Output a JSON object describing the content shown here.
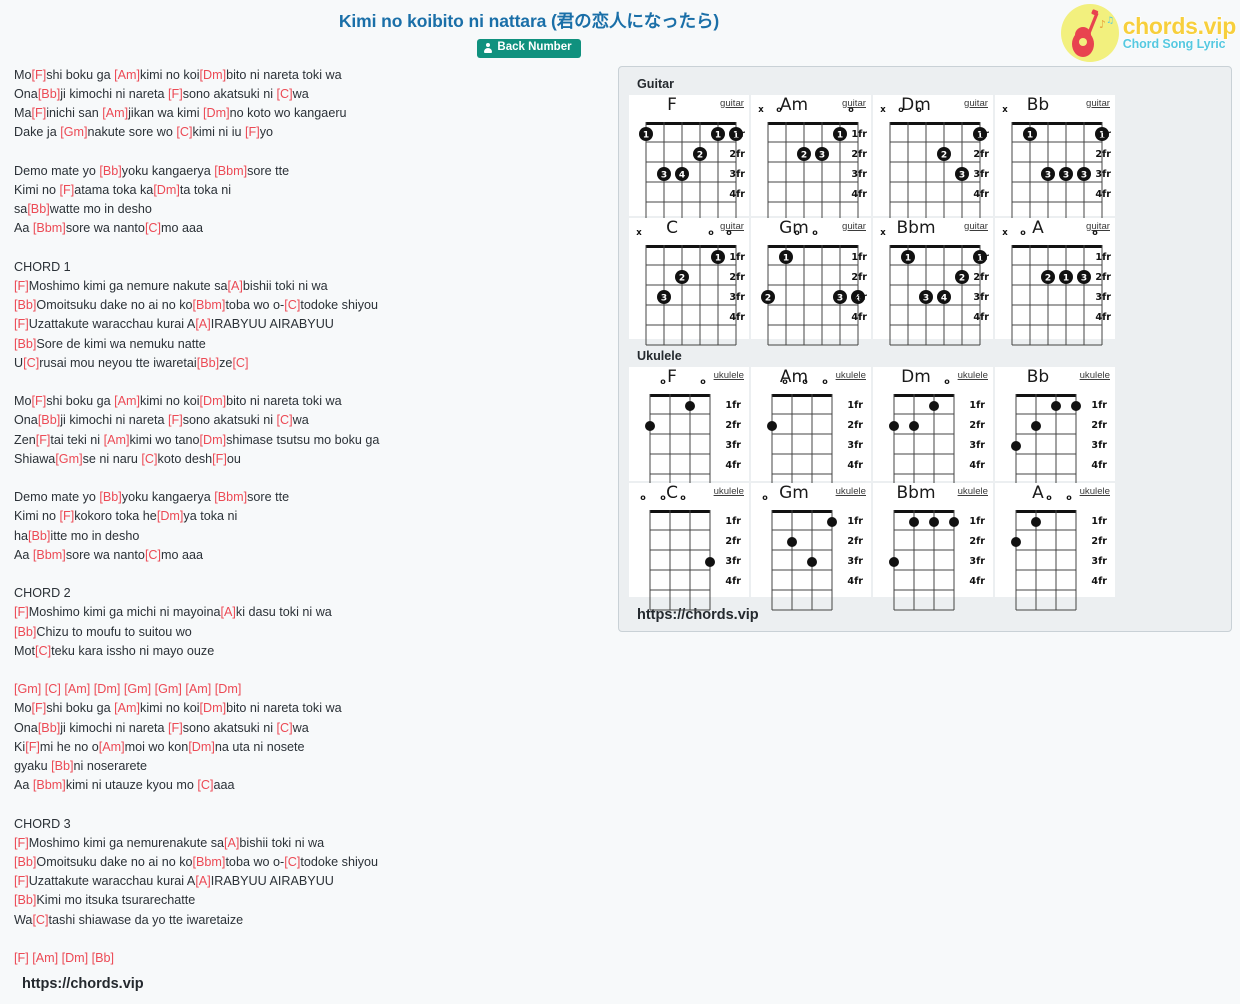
{
  "header": {
    "title": "Kimi no koibito ni nattara (君の恋人になったら)",
    "artist": "Back Number",
    "artist_icon": "user-icon"
  },
  "logo": {
    "main": "chords.vip",
    "sub": "Chord Song Lyric",
    "icon": "guitar-icon",
    "circle_color": "#f2f07e",
    "main_color": "#f7cf3c",
    "sub_color": "#55c8e0"
  },
  "colors": {
    "title": "#1a6fa8",
    "chord": "#ec4a55",
    "badge_bg": "#10917e",
    "panel_bg": "#eceff1",
    "panel_border": "#c9d1d6"
  },
  "lyrics": {
    "lines": [
      [
        {
          "t": "Mo"
        },
        {
          "c": "[F]"
        },
        {
          "t": "shi boku ga "
        },
        {
          "c": "[Am]"
        },
        {
          "t": "kimi no koi"
        },
        {
          "c": "[Dm]"
        },
        {
          "t": "bito ni nareta toki wa"
        }
      ],
      [
        {
          "t": "Ona"
        },
        {
          "c": "[Bb]"
        },
        {
          "t": "ji kimochi ni nareta "
        },
        {
          "c": "[F]"
        },
        {
          "t": "sono akatsuki ni "
        },
        {
          "c": "[C]"
        },
        {
          "t": "wa"
        }
      ],
      [
        {
          "t": "Ma"
        },
        {
          "c": "[F]"
        },
        {
          "t": "inichi san "
        },
        {
          "c": "[Am]"
        },
        {
          "t": "jikan wa kimi "
        },
        {
          "c": "[Dm]"
        },
        {
          "t": "no koto wo kangaeru"
        }
      ],
      [
        {
          "t": "Dake ja "
        },
        {
          "c": "[Gm]"
        },
        {
          "t": "nakute sore wo "
        },
        {
          "c": "[C]"
        },
        {
          "t": "kimi ni iu "
        },
        {
          "c": "[F]"
        },
        {
          "t": "yo"
        }
      ],
      [],
      [
        {
          "t": "Demo mate yo "
        },
        {
          "c": "[Bb]"
        },
        {
          "t": "yoku kangaerya "
        },
        {
          "c": "[Bbm]"
        },
        {
          "t": "sore tte"
        }
      ],
      [
        {
          "t": "Kimi no "
        },
        {
          "c": "[F]"
        },
        {
          "t": "atama toka ka"
        },
        {
          "c": "[Dm]"
        },
        {
          "t": "ta toka ni"
        }
      ],
      [
        {
          "t": "sa"
        },
        {
          "c": "[Bb]"
        },
        {
          "t": "watte mo in desho"
        }
      ],
      [
        {
          "t": "Aa "
        },
        {
          "c": "[Bbm]"
        },
        {
          "t": "sore wa nanto"
        },
        {
          "c": "[C]"
        },
        {
          "t": "mo aaa"
        }
      ],
      [],
      [
        {
          "t": "CHORD 1"
        }
      ],
      [
        {
          "c": "[F]"
        },
        {
          "t": "Moshimo kimi ga nemure nakute sa"
        },
        {
          "c": "[A]"
        },
        {
          "t": "bishii toki ni wa"
        }
      ],
      [
        {
          "c": "[Bb]"
        },
        {
          "t": "Omoitsuku dake no ai no ko"
        },
        {
          "c": "[Bbm]"
        },
        {
          "t": "toba wo o-"
        },
        {
          "c": "[C]"
        },
        {
          "t": "todoke shiyou"
        }
      ],
      [
        {
          "c": "[F]"
        },
        {
          "t": "Uzattakute waracchau kurai A"
        },
        {
          "c": "[A]"
        },
        {
          "t": "IRABYUU AIRABYUU"
        }
      ],
      [
        {
          "c": "[Bb]"
        },
        {
          "t": "Sore de kimi wa nemuku natte"
        }
      ],
      [
        {
          "t": "U"
        },
        {
          "c": "[C]"
        },
        {
          "t": "rusai mou neyou tte iwaretai"
        },
        {
          "c": "[Bb]"
        },
        {
          "t": "ze"
        },
        {
          "c": "[C]"
        }
      ],
      [],
      [
        {
          "t": "Mo"
        },
        {
          "c": "[F]"
        },
        {
          "t": "shi boku ga "
        },
        {
          "c": "[Am]"
        },
        {
          "t": "kimi no koi"
        },
        {
          "c": "[Dm]"
        },
        {
          "t": "bito ni nareta toki wa"
        }
      ],
      [
        {
          "t": "Ona"
        },
        {
          "c": "[Bb]"
        },
        {
          "t": "ji kimochi ni nareta "
        },
        {
          "c": "[F]"
        },
        {
          "t": "sono akatsuki ni "
        },
        {
          "c": "[C]"
        },
        {
          "t": "wa"
        }
      ],
      [
        {
          "t": "Zen"
        },
        {
          "c": "[F]"
        },
        {
          "t": "tai teki ni "
        },
        {
          "c": "[Am]"
        },
        {
          "t": "kimi wo tano"
        },
        {
          "c": "[Dm]"
        },
        {
          "t": "shimase tsutsu mo boku ga"
        }
      ],
      [
        {
          "t": "Shiawa"
        },
        {
          "c": "[Gm]"
        },
        {
          "t": "se ni naru "
        },
        {
          "c": "[C]"
        },
        {
          "t": "koto desh"
        },
        {
          "c": "[F]"
        },
        {
          "t": "ou"
        }
      ],
      [],
      [
        {
          "t": "Demo mate yo "
        },
        {
          "c": "[Bb]"
        },
        {
          "t": "yoku kangaerya "
        },
        {
          "c": "[Bbm]"
        },
        {
          "t": "sore tte"
        }
      ],
      [
        {
          "t": "Kimi no "
        },
        {
          "c": "[F]"
        },
        {
          "t": "kokoro toka he"
        },
        {
          "c": "[Dm]"
        },
        {
          "t": "ya toka ni"
        }
      ],
      [
        {
          "t": "ha"
        },
        {
          "c": "[Bb]"
        },
        {
          "t": "itte mo in desho"
        }
      ],
      [
        {
          "t": "Aa "
        },
        {
          "c": "[Bbm]"
        },
        {
          "t": "sore wa nanto"
        },
        {
          "c": "[C]"
        },
        {
          "t": "mo aaa"
        }
      ],
      [],
      [
        {
          "t": "CHORD 2"
        }
      ],
      [
        {
          "c": "[F]"
        },
        {
          "t": "Moshimo kimi ga michi ni mayoina"
        },
        {
          "c": "[A]"
        },
        {
          "t": "ki dasu toki ni wa"
        }
      ],
      [
        {
          "c": "[Bb]"
        },
        {
          "t": "Chizu to moufu to suitou wo"
        }
      ],
      [
        {
          "t": "Mot"
        },
        {
          "c": "[C]"
        },
        {
          "t": "teku kara issho ni mayo ouze"
        }
      ],
      [],
      [
        {
          "c": "[Gm] [C] [Am] [Dm] [Gm] [Gm] [Am] [Dm]"
        }
      ],
      [
        {
          "t": "Mo"
        },
        {
          "c": "[F]"
        },
        {
          "t": "shi boku ga "
        },
        {
          "c": "[Am]"
        },
        {
          "t": "kimi no koi"
        },
        {
          "c": "[Dm]"
        },
        {
          "t": "bito ni nareta toki wa"
        }
      ],
      [
        {
          "t": "Ona"
        },
        {
          "c": "[Bb]"
        },
        {
          "t": "ji kimochi ni nareta "
        },
        {
          "c": "[F]"
        },
        {
          "t": "sono akatsuki ni "
        },
        {
          "c": "[C]"
        },
        {
          "t": "wa"
        }
      ],
      [
        {
          "t": "Ki"
        },
        {
          "c": "[F]"
        },
        {
          "t": "mi he no o"
        },
        {
          "c": "[Am]"
        },
        {
          "t": "moi wo kon"
        },
        {
          "c": "[Dm]"
        },
        {
          "t": "na uta ni nosete"
        }
      ],
      [
        {
          "t": "gyaku "
        },
        {
          "c": "[Bb]"
        },
        {
          "t": "ni noserarete"
        }
      ],
      [
        {
          "t": "Aa "
        },
        {
          "c": "[Bbm]"
        },
        {
          "t": "kimi ni utauze kyou mo "
        },
        {
          "c": "[C]"
        },
        {
          "t": "aaa"
        }
      ],
      [],
      [
        {
          "t": "CHORD 3"
        }
      ],
      [
        {
          "c": "[F]"
        },
        {
          "t": "Moshimo kimi ga nemurenakute sa"
        },
        {
          "c": "[A]"
        },
        {
          "t": "bishii toki ni wa"
        }
      ],
      [
        {
          "c": "[Bb]"
        },
        {
          "t": "Omoitsuku dake no ai no ko"
        },
        {
          "c": "[Bbm]"
        },
        {
          "t": "toba wo o-"
        },
        {
          "c": "[C]"
        },
        {
          "t": "todoke shiyou"
        }
      ],
      [
        {
          "c": "[F]"
        },
        {
          "t": "Uzattakute waracchau kurai A"
        },
        {
          "c": "[A]"
        },
        {
          "t": "IRABYUU AIRABYUU"
        }
      ],
      [
        {
          "c": "[Bb]"
        },
        {
          "t": "Kimi mo itsuka tsurarechatte"
        }
      ],
      [
        {
          "t": "Wa"
        },
        {
          "c": "[C]"
        },
        {
          "t": "tashi shiawase da yo tte iwaretaize"
        }
      ],
      [],
      [
        {
          "c": "[F] [Am] [Dm] [Bb]"
        }
      ]
    ],
    "footer_url": "https://chords.vip"
  },
  "chord_panel": {
    "guitar_label": "Guitar",
    "ukulele_label": "Ukulele",
    "fret_labels": [
      "1fr",
      "2fr",
      "3fr",
      "4fr"
    ],
    "footer_url": "https://chords.vip",
    "guitar_type_label": "guitar",
    "ukulele_type_label": "ukulele",
    "guitar": [
      {
        "name": "F",
        "type": "guitar",
        "marks": [],
        "dots": [
          {
            "s": 1,
            "f": 1,
            "n": "1"
          },
          {
            "s": 5,
            "f": 1,
            "n": "1"
          },
          {
            "s": 6,
            "f": 1,
            "n": "1"
          },
          {
            "s": 4,
            "f": 2,
            "n": "2"
          },
          {
            "s": 2,
            "f": 3,
            "n": "3"
          },
          {
            "s": 3,
            "f": 3,
            "n": "4"
          }
        ]
      },
      {
        "name": "Am",
        "type": "guitar",
        "marks": [
          {
            "s": 1,
            "m": "x"
          },
          {
            "s": 2,
            "m": "o"
          },
          {
            "s": 6,
            "m": "o"
          }
        ],
        "dots": [
          {
            "s": 5,
            "f": 1,
            "n": "1"
          },
          {
            "s": 3,
            "f": 2,
            "n": "2"
          },
          {
            "s": 4,
            "f": 2,
            "n": "3"
          }
        ]
      },
      {
        "name": "Dm",
        "type": "guitar",
        "marks": [
          {
            "s": 1,
            "m": "x"
          },
          {
            "s": 2,
            "m": "o"
          },
          {
            "s": 3,
            "m": "o"
          }
        ],
        "dots": [
          {
            "s": 6,
            "f": 1,
            "n": "1"
          },
          {
            "s": 4,
            "f": 2,
            "n": "2"
          },
          {
            "s": 5,
            "f": 3,
            "n": "3"
          }
        ]
      },
      {
        "name": "Bb",
        "type": "guitar",
        "marks": [
          {
            "s": 1,
            "m": "x"
          }
        ],
        "dots": [
          {
            "s": 2,
            "f": 1,
            "n": "1"
          },
          {
            "s": 6,
            "f": 1,
            "n": "1"
          },
          {
            "s": 3,
            "f": 3,
            "n": "3"
          },
          {
            "s": 4,
            "f": 3,
            "n": "3"
          },
          {
            "s": 5,
            "f": 3,
            "n": "3"
          }
        ]
      },
      {
        "name": "C",
        "type": "guitar",
        "marks": [
          {
            "s": 1,
            "m": "x"
          },
          {
            "s": 5,
            "m": "o"
          },
          {
            "s": 6,
            "m": "o"
          }
        ],
        "dots": [
          {
            "s": 5,
            "f": 1,
            "n": "1"
          },
          {
            "s": 3,
            "f": 2,
            "n": "2"
          },
          {
            "s": 2,
            "f": 3,
            "n": "3"
          }
        ]
      },
      {
        "name": "Gm",
        "type": "guitar",
        "marks": [
          {
            "s": 3,
            "m": "o"
          },
          {
            "s": 4,
            "m": "o"
          }
        ],
        "dots": [
          {
            "s": 2,
            "f": 1,
            "n": "1"
          },
          {
            "s": 1,
            "f": 3,
            "n": "2"
          },
          {
            "s": 5,
            "f": 3,
            "n": "3"
          },
          {
            "s": 6,
            "f": 3,
            "n": "4"
          }
        ]
      },
      {
        "name": "Bbm",
        "type": "guitar",
        "marks": [
          {
            "s": 1,
            "m": "x"
          }
        ],
        "dots": [
          {
            "s": 2,
            "f": 1,
            "n": "1"
          },
          {
            "s": 6,
            "f": 1,
            "n": "1"
          },
          {
            "s": 5,
            "f": 2,
            "n": "2"
          },
          {
            "s": 3,
            "f": 3,
            "n": "3"
          },
          {
            "s": 4,
            "f": 3,
            "n": "4"
          }
        ]
      },
      {
        "name": "A",
        "type": "guitar",
        "marks": [
          {
            "s": 1,
            "m": "x"
          },
          {
            "s": 2,
            "m": "o"
          },
          {
            "s": 6,
            "m": "o"
          }
        ],
        "dots": [
          {
            "s": 3,
            "f": 2,
            "n": "2"
          },
          {
            "s": 4,
            "f": 2,
            "n": "1"
          },
          {
            "s": 5,
            "f": 2,
            "n": "3"
          }
        ]
      }
    ],
    "ukulele": [
      {
        "name": "F",
        "type": "ukulele",
        "marks": [
          {
            "s": 2,
            "m": "o"
          },
          {
            "s": 4,
            "m": "o"
          }
        ],
        "dots": [
          {
            "s": 3,
            "f": 1,
            "n": ""
          },
          {
            "s": 1,
            "f": 2,
            "n": ""
          }
        ]
      },
      {
        "name": "Am",
        "type": "ukulele",
        "marks": [
          {
            "s": 2,
            "m": "o"
          },
          {
            "s": 3,
            "m": "o"
          },
          {
            "s": 4,
            "m": "o"
          }
        ],
        "dots": [
          {
            "s": 1,
            "f": 2,
            "n": ""
          }
        ]
      },
      {
        "name": "Dm",
        "type": "ukulele",
        "marks": [
          {
            "s": 4,
            "m": "o"
          }
        ],
        "dots": [
          {
            "s": 3,
            "f": 1,
            "n": ""
          },
          {
            "s": 1,
            "f": 2,
            "n": ""
          },
          {
            "s": 2,
            "f": 2,
            "n": ""
          }
        ]
      },
      {
        "name": "Bb",
        "type": "ukulele",
        "marks": [],
        "dots": [
          {
            "s": 3,
            "f": 1,
            "n": ""
          },
          {
            "s": 4,
            "f": 1,
            "n": ""
          },
          {
            "s": 2,
            "f": 2,
            "n": ""
          },
          {
            "s": 1,
            "f": 3,
            "n": ""
          }
        ]
      },
      {
        "name": "C",
        "type": "ukulele",
        "marks": [
          {
            "s": 1,
            "m": "o"
          },
          {
            "s": 2,
            "m": "o"
          },
          {
            "s": 3,
            "m": "o"
          }
        ],
        "dots": [
          {
            "s": 4,
            "f": 3,
            "n": ""
          }
        ]
      },
      {
        "name": "Gm",
        "type": "ukulele",
        "marks": [
          {
            "s": 1,
            "m": "o"
          }
        ],
        "dots": [
          {
            "s": 4,
            "f": 1,
            "n": ""
          },
          {
            "s": 2,
            "f": 2,
            "n": ""
          },
          {
            "s": 3,
            "f": 3,
            "n": ""
          }
        ]
      },
      {
        "name": "Bbm",
        "type": "ukulele",
        "marks": [],
        "dots": [
          {
            "s": 2,
            "f": 1,
            "n": ""
          },
          {
            "s": 3,
            "f": 1,
            "n": ""
          },
          {
            "s": 4,
            "f": 1,
            "n": ""
          },
          {
            "s": 1,
            "f": 3,
            "n": ""
          }
        ]
      },
      {
        "name": "A",
        "type": "ukulele",
        "marks": [
          {
            "s": 3,
            "m": "o"
          },
          {
            "s": 4,
            "m": "o"
          }
        ],
        "dots": [
          {
            "s": 2,
            "f": 1,
            "n": ""
          },
          {
            "s": 1,
            "f": 2,
            "n": ""
          }
        ]
      }
    ]
  }
}
